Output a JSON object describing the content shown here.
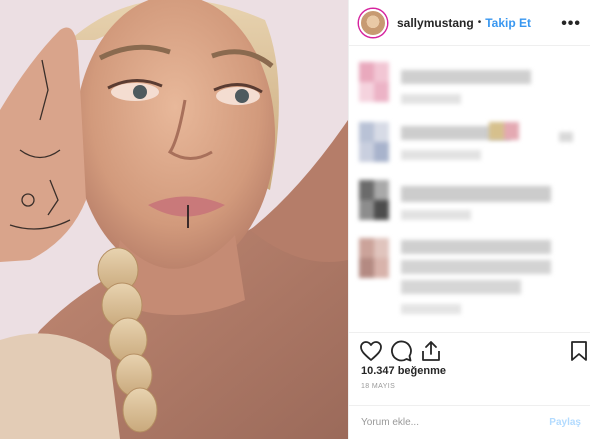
{
  "header": {
    "username": "sallymustang",
    "separator": "•",
    "follow_label": "Takip Et",
    "more_icon": "more-options-icon"
  },
  "post": {
    "likes_text": "10.347 beğenme",
    "date_text": "18 MAYIS"
  },
  "actions": {
    "like_icon": "heart-icon",
    "comment_icon": "comment-icon",
    "share_icon": "share-icon",
    "save_icon": "bookmark-icon"
  },
  "composer": {
    "placeholder": "Yorum ekle...",
    "post_label": "Paylaş"
  },
  "colors": {
    "link_blue": "#3897f0",
    "post_disabled": "#b3dbff",
    "border": "#efefef",
    "text": "#262626",
    "muted": "#999999"
  }
}
